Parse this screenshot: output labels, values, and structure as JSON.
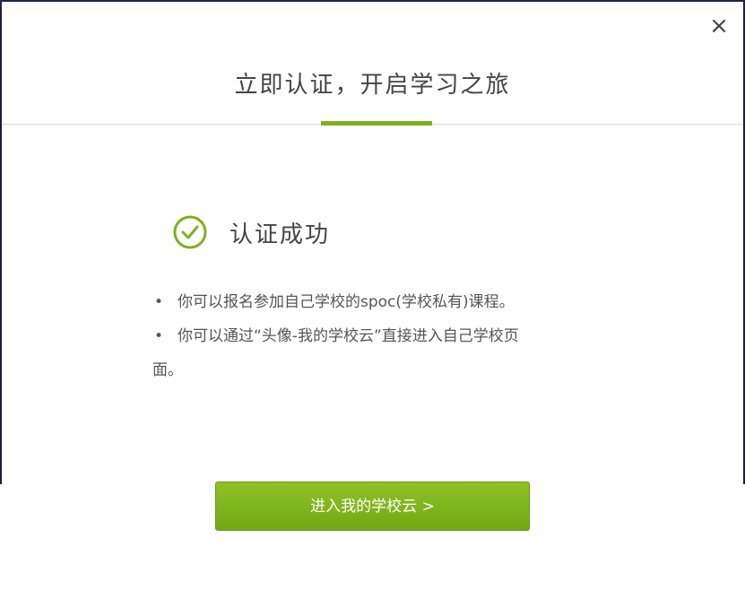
{
  "dialog": {
    "close_symbol": "×",
    "title": "立即认证，开启学习之旅",
    "accent_color": "#7fb01c"
  },
  "status": {
    "icon": "check-circle-icon",
    "text": "认证成功"
  },
  "info": {
    "bullet": "•",
    "item1": "你可以报名参加自己学校的spoc(学校私有)课程。",
    "item2_line1": "你可以通过“头像-我的学校云”直接进入自己学校页",
    "item2_line2": "面。"
  },
  "actions": {
    "enter_school_cloud": "进入我的学校云 >"
  }
}
